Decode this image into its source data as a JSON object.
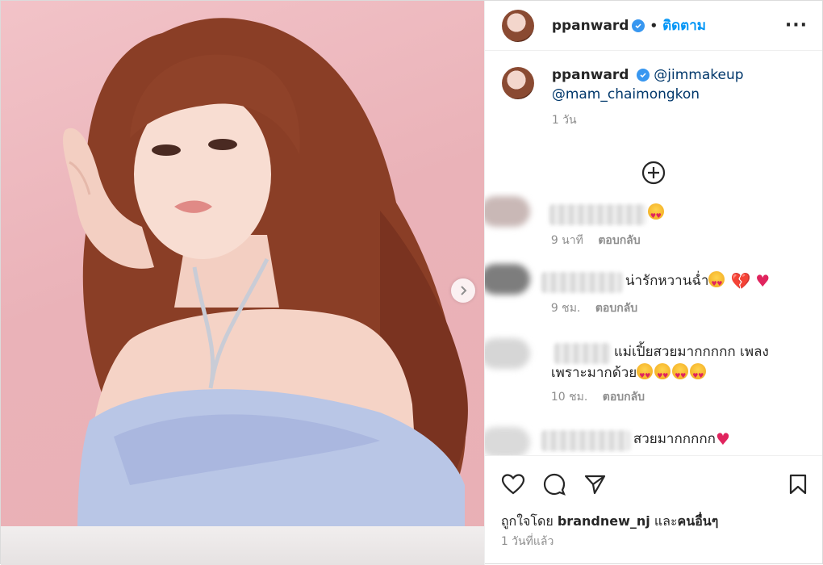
{
  "post": {
    "username": "ppanward",
    "dot": "•",
    "follow_label": "ติดตาม",
    "more_label": "···"
  },
  "caption": {
    "username": "ppanward",
    "mention_1": "@jimmakeup",
    "mention_2": "@mam_chaimongkon",
    "time": "1 วัน"
  },
  "comments": [
    {
      "text": "",
      "emojis": [
        "heart-eyes"
      ],
      "time": "9 นาที",
      "reply": "ตอบกลับ"
    },
    {
      "text": "น่ารักหวานฉ่ำ",
      "emojis": [
        "heart-eyes",
        "broken-heart",
        "red-heart"
      ],
      "time": "9 ชม.",
      "reply": "ตอบกลับ"
    },
    {
      "text_line1": "แม่เปิ้ยสวยมากกกกก เพลง",
      "text_line2": "เพราะมากด้วย",
      "emojis": [
        "heart-eyes",
        "heart-eyes",
        "heart-eyes",
        "heart-eyes"
      ],
      "time": "10 ชม.",
      "reply": "ตอบกลับ"
    },
    {
      "text": "สวยมากกกกก",
      "emojis": [
        "red-heart"
      ]
    }
  ],
  "likes": {
    "prefix": "ถูกใจโดย",
    "user": "brandnew_nj",
    "conj": "และ",
    "others": "คนอื่นๆ"
  },
  "posted_time": "1 วันที่แล้ว",
  "colors": {
    "accent": "#0095f6",
    "verified": "#3897f0",
    "heart": "#e0245e",
    "bg_pink": "#eab2b8"
  },
  "icons": [
    "chevron-right-icon",
    "verified-icon",
    "plus-circle-icon",
    "heart-icon",
    "comment-icon",
    "share-icon",
    "bookmark-icon"
  ]
}
